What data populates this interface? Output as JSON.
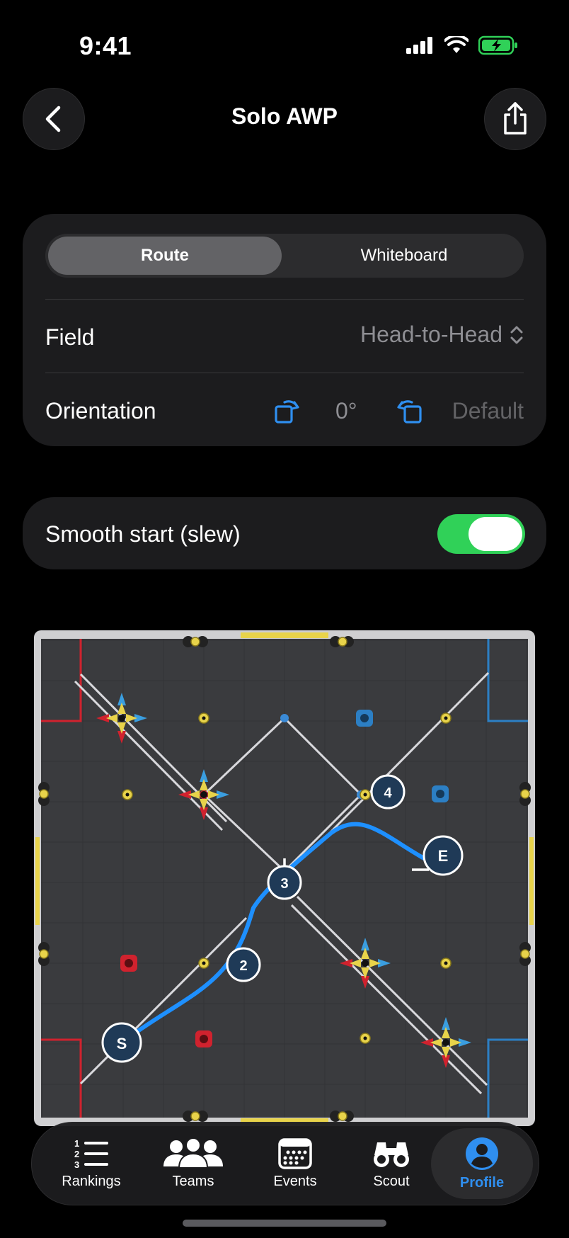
{
  "status_bar": {
    "time": "9:41"
  },
  "header": {
    "title": "Solo AWP"
  },
  "settings": {
    "tabs": [
      "Route",
      "Whiteboard"
    ],
    "active_tab": "Route",
    "field_label": "Field",
    "field_value": "Head-to-Head",
    "orientation_label": "Orientation",
    "orientation_value": "0°",
    "orientation_default": "Default"
  },
  "slew": {
    "label": "Smooth start (slew)",
    "enabled": true
  },
  "route": {
    "points": [
      "S",
      "2",
      "3",
      "4",
      "E"
    ]
  },
  "tabbar": {
    "items": [
      {
        "label": "Rankings",
        "icon": "list-numbered-icon"
      },
      {
        "label": "Teams",
        "icon": "people-icon"
      },
      {
        "label": "Events",
        "icon": "calendar-icon"
      },
      {
        "label": "Scout",
        "icon": "binoculars-icon"
      },
      {
        "label": "Profile",
        "icon": "person-circle-icon"
      }
    ],
    "active": "Profile"
  },
  "colors": {
    "accent": "#2f8ff0",
    "toggle_on": "#30d158",
    "alliance_red": "#d0222e",
    "alliance_blue": "#2c7fc4",
    "ring_yellow": "#e8d34a"
  }
}
